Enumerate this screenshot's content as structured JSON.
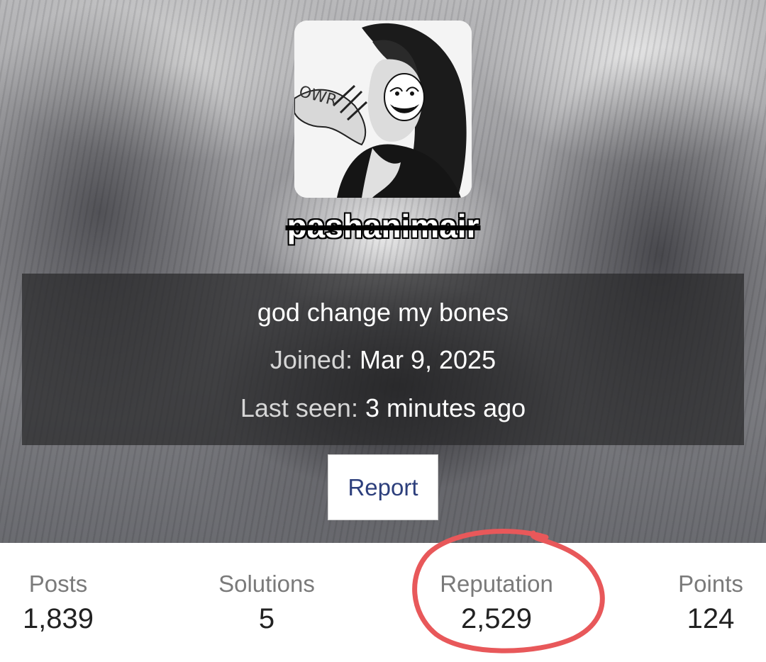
{
  "profile": {
    "username": "pashanimair",
    "bio": "god change my bones",
    "joined_label": "Joined:",
    "joined_value": "Mar 9, 2025",
    "last_seen_label": "Last seen:",
    "last_seen_value": "3 minutes ago",
    "avatar_sign_text": "OWR"
  },
  "actions": {
    "report_label": "Report"
  },
  "stats": {
    "posts_label": "Posts",
    "posts_value": "1,839",
    "solutions_label": "Solutions",
    "solutions_value": "5",
    "reputation_label": "Reputation",
    "reputation_value": "2,529",
    "points_label": "Points",
    "points_value": "124"
  },
  "colors": {
    "report_text": "#2d3f7c",
    "annotation_circle": "#e8585a",
    "stat_label": "#7a7a7a",
    "stat_value": "#222222"
  }
}
